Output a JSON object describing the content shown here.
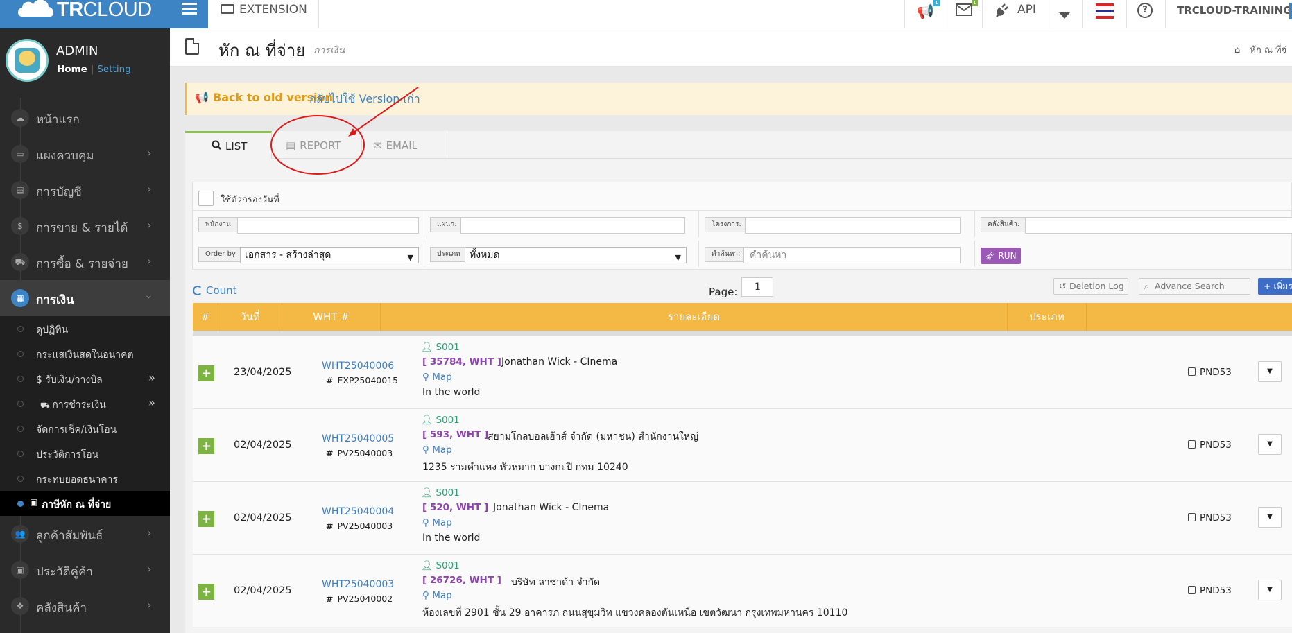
{
  "topbar": {
    "brand_bold": "TR",
    "brand_light": "CLOUD",
    "extension_label": "EXTENSION",
    "badge1": "1",
    "badge2": "1",
    "api_label": "API",
    "company": "TRCLOUD-TRAINING",
    "icons": [
      "menu-icon",
      "monitor-icon",
      "megaphone-icon",
      "mail-icon",
      "plug-icon",
      "caret-down-icon",
      "thai-flag-icon",
      "help-icon"
    ]
  },
  "sidebar": {
    "admin_name": "ADMIN",
    "home_link": "Home",
    "separator": "|",
    "setting_link": "Setting",
    "menu": [
      {
        "label": "หน้าแรก",
        "icon": "cloud-icon"
      },
      {
        "label": "แผงควบคุม",
        "icon": "monitor-icon"
      },
      {
        "label": "การบัญชี",
        "icon": "book-icon"
      },
      {
        "label": "การขาย & รายได้",
        "icon": "dollar-icon"
      },
      {
        "label": "การซื้อ & รายจ่าย",
        "icon": "cart-icon"
      },
      {
        "label": "การเงิน",
        "icon": "calendar-icon"
      },
      {
        "label": "ลูกค้าสัมพันธ์",
        "icon": "users-icon"
      },
      {
        "label": "ประวัติคู่ค้า",
        "icon": "contact-icon"
      },
      {
        "label": "คลังสินค้า",
        "icon": "cubes-icon"
      }
    ],
    "submenu": [
      {
        "label": "ดูปฏิทิน"
      },
      {
        "label": "กระแสเงินสดในอนาคต"
      },
      {
        "label": "$ รับเงิน/วางบิล"
      },
      {
        "label": "การชำระเงิน"
      },
      {
        "label": "จัดการเช็ค/เงินโอน"
      },
      {
        "label": "ประวัติการโอน"
      },
      {
        "label": "กระทบยอดธนาคาร"
      },
      {
        "label": "ภาษีหัก ณ ที่จ่าย"
      }
    ]
  },
  "page": {
    "title": "หัก ณ ที่จ่าย",
    "subtitle": "การเงิน",
    "breadcrumb": "หัก ณ ที่จ่",
    "notice_title": "Back to old version",
    "notice_link": "กลับไปใช้ Version เก่า"
  },
  "tabs": [
    {
      "label": "LIST",
      "icon": "search-icon",
      "active": true
    },
    {
      "label": "REPORT",
      "icon": "file-icon",
      "active": false
    },
    {
      "label": "EMAIL",
      "icon": "envelope-icon",
      "active": false
    }
  ],
  "filters": {
    "date_filter_label": "ใช้ตัวกรองวันที่",
    "employee_label": "พนักงาน:",
    "employee_value": "",
    "department_label": "แผนก:",
    "department_value": "",
    "project_label": "โครงการ:",
    "project_value": "",
    "warehouse_label": "คลังสินค้า:",
    "warehouse_value": "",
    "order_label": "Order by",
    "order_value": "เอกสาร - สร้างล่าสุด",
    "type_label": "ประเภท",
    "type_value": "ทั้งหมด",
    "search_label": "คำค้นหา:",
    "search_placeholder": "คำค้นหา",
    "run_label": "RUN"
  },
  "list": {
    "count_label": "Count",
    "page_label": "Page:",
    "page_value": "1",
    "deletion_log": "Deletion Log",
    "advance_search": "Advance Search",
    "add_label": "+ เพิ่มรายการ",
    "columns": [
      "#",
      "วันที่",
      "WHT #",
      "รายละเอียด",
      "ประเภท",
      ""
    ],
    "rows": [
      {
        "date": "23/04/2025",
        "wht": "WHT25040006",
        "ref": "EXP25040015",
        "sales": "S001",
        "code": "[ 35784, WHT ]",
        "name": "Jonathan Wick - CInema",
        "map": "Map",
        "address": "In the world",
        "type": "PND53"
      },
      {
        "date": "02/04/2025",
        "wht": "WHT25040005",
        "ref": "PV25040003",
        "sales": "S001",
        "code": "[ 593, WHT ]",
        "name": "สยามโกลบอลเฮ้าส์ จำกัด (มหาชน) สำนักงานใหญ่",
        "map": "Map",
        "address": "1235 รามคำแหง หัวหมาก บางกะปิ กทม 10240",
        "type": "PND53"
      },
      {
        "date": "02/04/2025",
        "wht": "WHT25040004",
        "ref": "PV25040003",
        "sales": "S001",
        "code": "[ 520, WHT ]",
        "name": "Jonathan Wick - CInema",
        "map": "Map",
        "address": "In the world",
        "type": "PND53"
      },
      {
        "date": "02/04/2025",
        "wht": "WHT25040003",
        "ref": "PV25040002",
        "sales": "S001",
        "code": "[ 26726, WHT ]",
        "name": "บริษัท ลาซาด้า จำกัด",
        "map": "Map",
        "address": "ห้องเลขที่ 2901 ชั้น 29 อาคารภ ถนนสุขุมวิท แขวงคลองตันเหนือ เขตวัฒนา กรุงเทพมหานคร 10110",
        "type": "PND53"
      }
    ]
  },
  "annotation": {
    "color": "#e01818"
  }
}
